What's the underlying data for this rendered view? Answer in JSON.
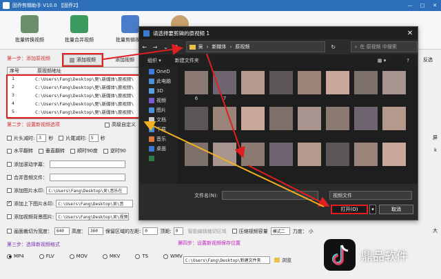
{
  "app": {
    "title": "固乔剪辑助手 V10.0 【固乔2】",
    "win_controls": [
      "—",
      "□",
      "✕"
    ]
  },
  "toolbar": {
    "tools": [
      {
        "label": "批量转换视频",
        "color": "#6b8e6b"
      },
      {
        "label": "批量合并视频",
        "color": "#3d9a5e"
      },
      {
        "label": "批量剪辑视频",
        "color": "#4a7dc9"
      },
      {
        "label": "",
        "color": "#c9a06b"
      }
    ]
  },
  "step1": {
    "label": "第一步：添加原视频",
    "add_button": "添加视频",
    "add_button2": "添加视频",
    "reverse_button": "反选"
  },
  "file_table": {
    "headers": [
      "序号",
      "原视频地址"
    ],
    "rows": [
      {
        "num": "1",
        "path": "C:\\Users\\Fang\\Desktop\\吴\\新媒体\\原视频\\"
      },
      {
        "num": "2",
        "path": "C:\\Users\\Fang\\Desktop\\吴\\新媒体\\原视频\\"
      },
      {
        "num": "3",
        "path": "C:\\Users\\Fang\\Desktop\\吴\\新媒体\\原视频\\"
      },
      {
        "num": "4",
        "path": "C:\\Users\\Fang\\Desktop\\吴\\新媒体\\原视频\\"
      },
      {
        "num": "5",
        "path": "C:\\Users\\Fang\\Desktop\\吴\\新媒体\\原视频\\"
      }
    ]
  },
  "step2": {
    "label": "第二步：设置新视频选项",
    "advanced": "高级自定义",
    "opt_head_cut": "片头减时:",
    "opt_head_val": "3",
    "opt_head_unit": "秒",
    "opt_tail_cut": "片尾减时:",
    "opt_tail_val": "5",
    "opt_tail_unit": "秒",
    "opt_hflip": "水平翻转",
    "opt_vflip": "垂直翻转",
    "opt_rot90": "顺时90度",
    "opt_rot_ccw": "逆时90",
    "opt_subtitle": "添加滚动字幕：",
    "opt_audio": "合并音频文件：",
    "opt_image_watermark": "添加图片水印:",
    "opt_image_watermark_path": "C:\\Users\\Fang\\Desktop\\吴\\音乐在",
    "opt_top_bottom": "添加上下图片水印:",
    "opt_top_bottom_path": "C:\\Users\\Fang\\Desktop\\吴\\音",
    "opt_bg_image": "添加视频背景图片:",
    "opt_bg_image_path": "C:\\Users\\Fang\\Desktop\\吴\\视频",
    "opt_crop": "画面裁切为宽度：",
    "opt_crop_w": "640",
    "opt_crop_h_label": "高度：",
    "opt_crop_h": "360",
    "opt_crop_note": "保留区域的左距:",
    "opt_crop_note_val": "0",
    "opt_top_dist": "顶距:",
    "opt_top_dist_val": "0",
    "opt_smart_crop": "智能编辑裁切区域",
    "opt_compress": "压缩视频容量",
    "opt_mode": "模式二",
    "opt_strength": "力度：",
    "opt_strength_small": "小",
    "opt_strength_big": "大",
    "right_edge": "屏",
    "right_edge2": "k"
  },
  "step3": {
    "label": "第三步：选择新视频格式",
    "formats": [
      "MP4",
      "FLV",
      "MOV",
      "MKV",
      "TS",
      "WMV"
    ],
    "selected": "MP4"
  },
  "step4": {
    "label": "第四步：设置新视频保存位置",
    "path": "C:\\Users\\Fang\\Desktop\\新建文件夹",
    "browse": "浏览"
  },
  "dialog": {
    "title": "请选择要剪辑的原视频 1",
    "close": "✕",
    "breadcrumb": [
      "吴",
      "新媒体",
      "原视频"
    ],
    "search_placeholder": "在 原视频 中搜索",
    "organize": "组织 ▾",
    "new_folder": "新建文件夹",
    "sidebar": [
      {
        "label": "OneD",
        "color": "#3b7dd8"
      },
      {
        "label": "此电脑",
        "color": "#4a90d9"
      },
      {
        "label": "3D",
        "color": "#5aa0e0"
      },
      {
        "label": "视频",
        "color": "#7b5bd0"
      },
      {
        "label": "图片",
        "color": "#4a90d9"
      },
      {
        "label": "文档",
        "color": "#cccccc"
      },
      {
        "label": "下载",
        "color": "#3b8bd8"
      },
      {
        "label": "音乐",
        "color": "#e07a3a"
      },
      {
        "label": "桌面",
        "color": "#3a7bd0"
      },
      {
        "label": "",
        "color": "#2c7a4a"
      }
    ],
    "thumb_labels": [
      "6",
      "7"
    ],
    "filename_label": "文件名(N):",
    "filetype": "视频文件",
    "open_button": "打开(O)",
    "cancel_button": "取消"
  },
  "watermark": {
    "text": "鼎品软件"
  }
}
